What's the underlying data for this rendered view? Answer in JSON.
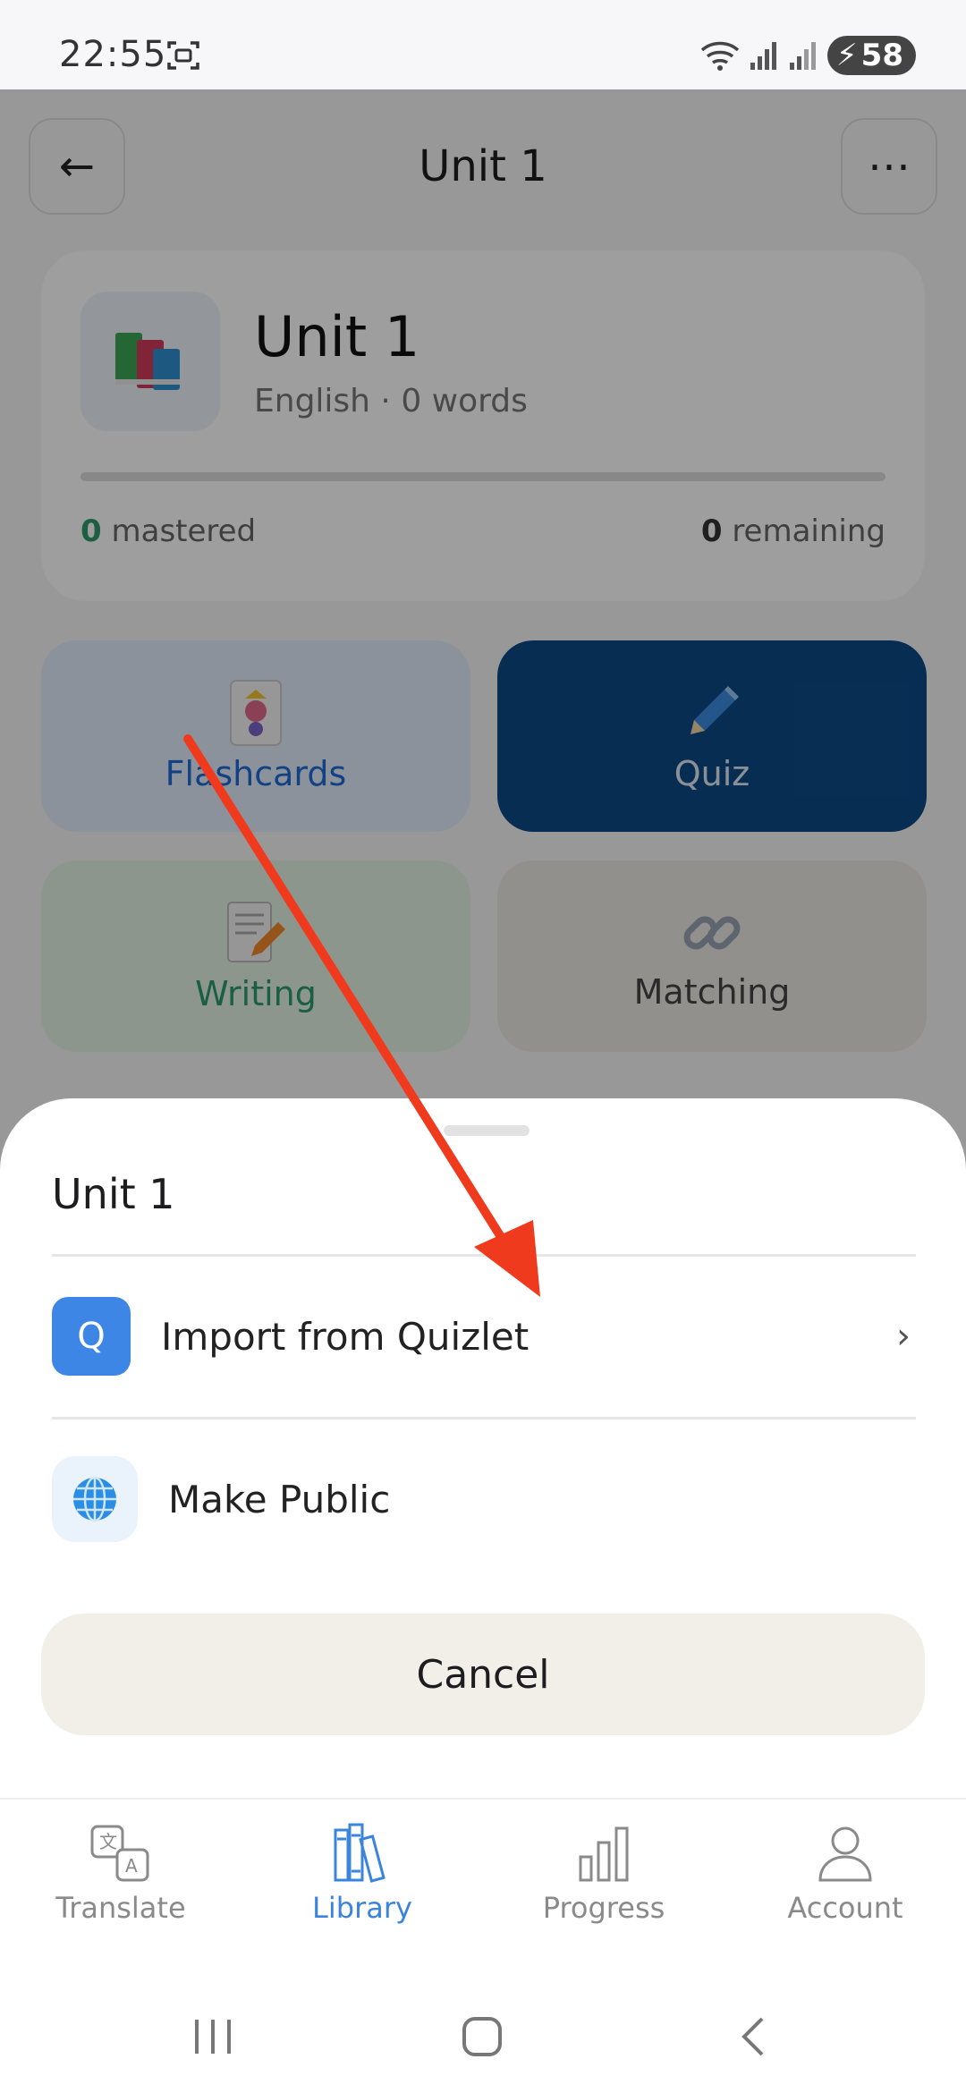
{
  "status_bar": {
    "time": "22:55",
    "battery": "58"
  },
  "header": {
    "back_glyph": "←",
    "title": "Unit 1",
    "more_glyph": "⋯"
  },
  "deck": {
    "title": "Unit 1",
    "subtitle": "English · 0 words",
    "progress": 0,
    "mastered_count": "0",
    "mastered_label": "mastered",
    "remaining_count": "0",
    "remaining_label": "remaining"
  },
  "modes": {
    "flashcards": "Flashcards",
    "quiz": "Quiz",
    "writing": "Writing",
    "matching": "Matching"
  },
  "sheet": {
    "title": "Unit 1",
    "options": [
      {
        "icon_text": "Q",
        "label": "Import from Quizlet",
        "chevron": "›"
      },
      {
        "icon": "globe-icon",
        "label": "Make Public"
      }
    ],
    "cancel": "Cancel"
  },
  "nav": {
    "items": [
      {
        "label": "Translate",
        "icon": "translate-icon"
      },
      {
        "label": "Library",
        "icon": "library-icon",
        "active": true
      },
      {
        "label": "Progress",
        "icon": "progress-icon"
      },
      {
        "label": "Account",
        "icon": "account-icon"
      }
    ]
  },
  "colors": {
    "accent": "#3a84dd",
    "quiz_bg": "#0d4a86",
    "annotation": "#f03a1e"
  }
}
